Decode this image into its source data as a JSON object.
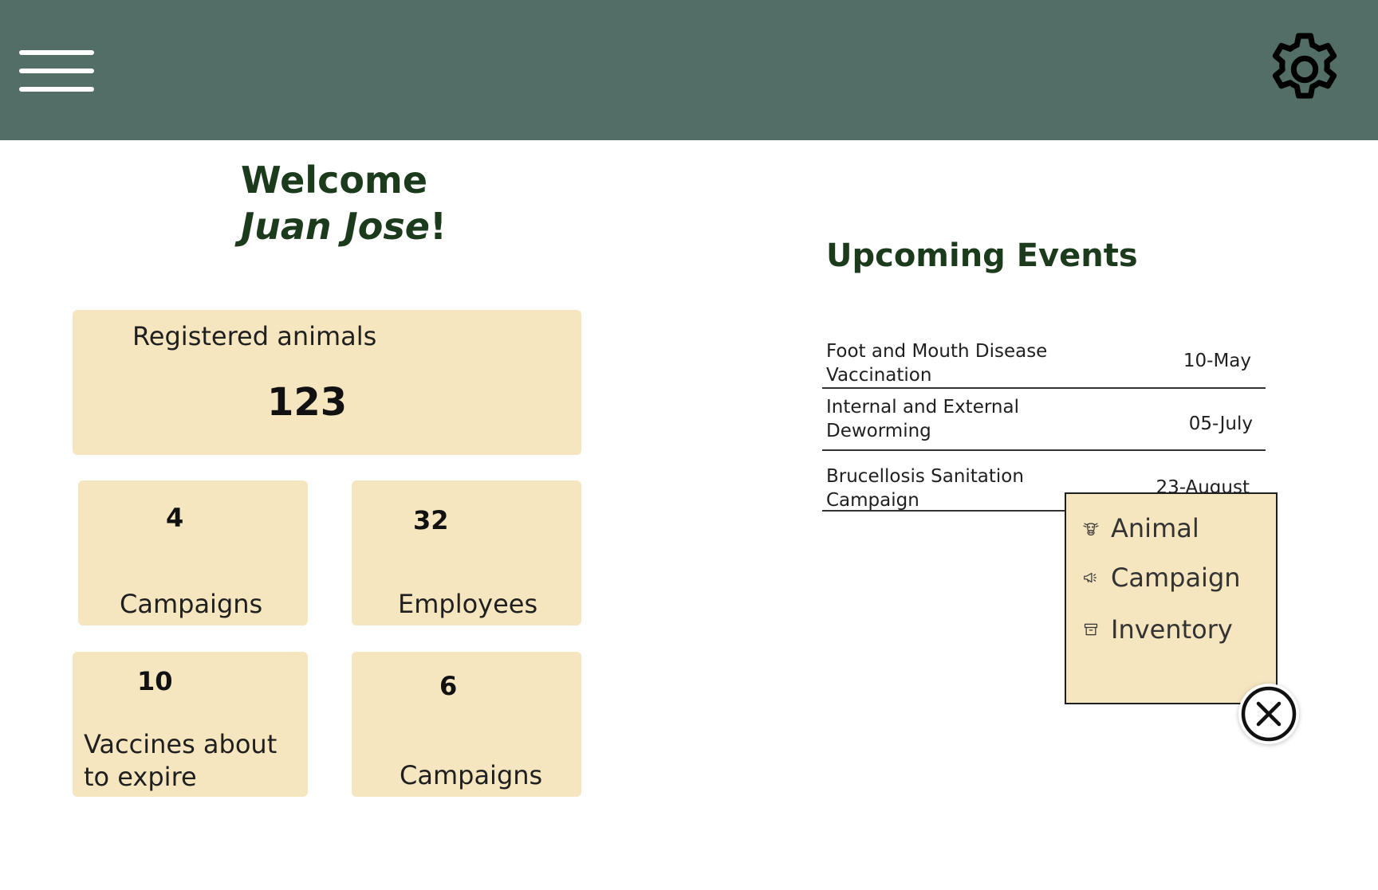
{
  "header": {
    "menu_icon": "hamburger-icon",
    "settings_icon": "gear-icon",
    "background_color": "#526e66"
  },
  "welcome": {
    "greeting": "Welcome",
    "user_name": "Juan Jose",
    "punctuation": "!"
  },
  "stats": {
    "registered": {
      "label": "Registered animals",
      "value": "123"
    },
    "campaigns": {
      "label": "Campaigns",
      "value": "4"
    },
    "employees": {
      "label": "Employees",
      "value": "32"
    },
    "vaccines": {
      "label": "Vaccines about to expire",
      "value": "10"
    },
    "campaigns2": {
      "label": "Campaigns",
      "value": "6"
    },
    "card_color": "#f5e6c0"
  },
  "events": {
    "title": "Upcoming Events",
    "items": [
      {
        "name": "Foot and Mouth Disease Vaccination",
        "date": "10-May"
      },
      {
        "name": "Internal and External Deworming",
        "date": "05-July"
      },
      {
        "name": "Brucellosis Sanitation Campaign",
        "date": "23-August"
      }
    ]
  },
  "quick_menu": {
    "items": [
      {
        "label": "Animal",
        "icon": "cow-icon"
      },
      {
        "label": "Campaign",
        "icon": "megaphone-icon"
      },
      {
        "label": "Inventory",
        "icon": "archive-box-icon"
      }
    ],
    "close_icon": "close-icon"
  }
}
